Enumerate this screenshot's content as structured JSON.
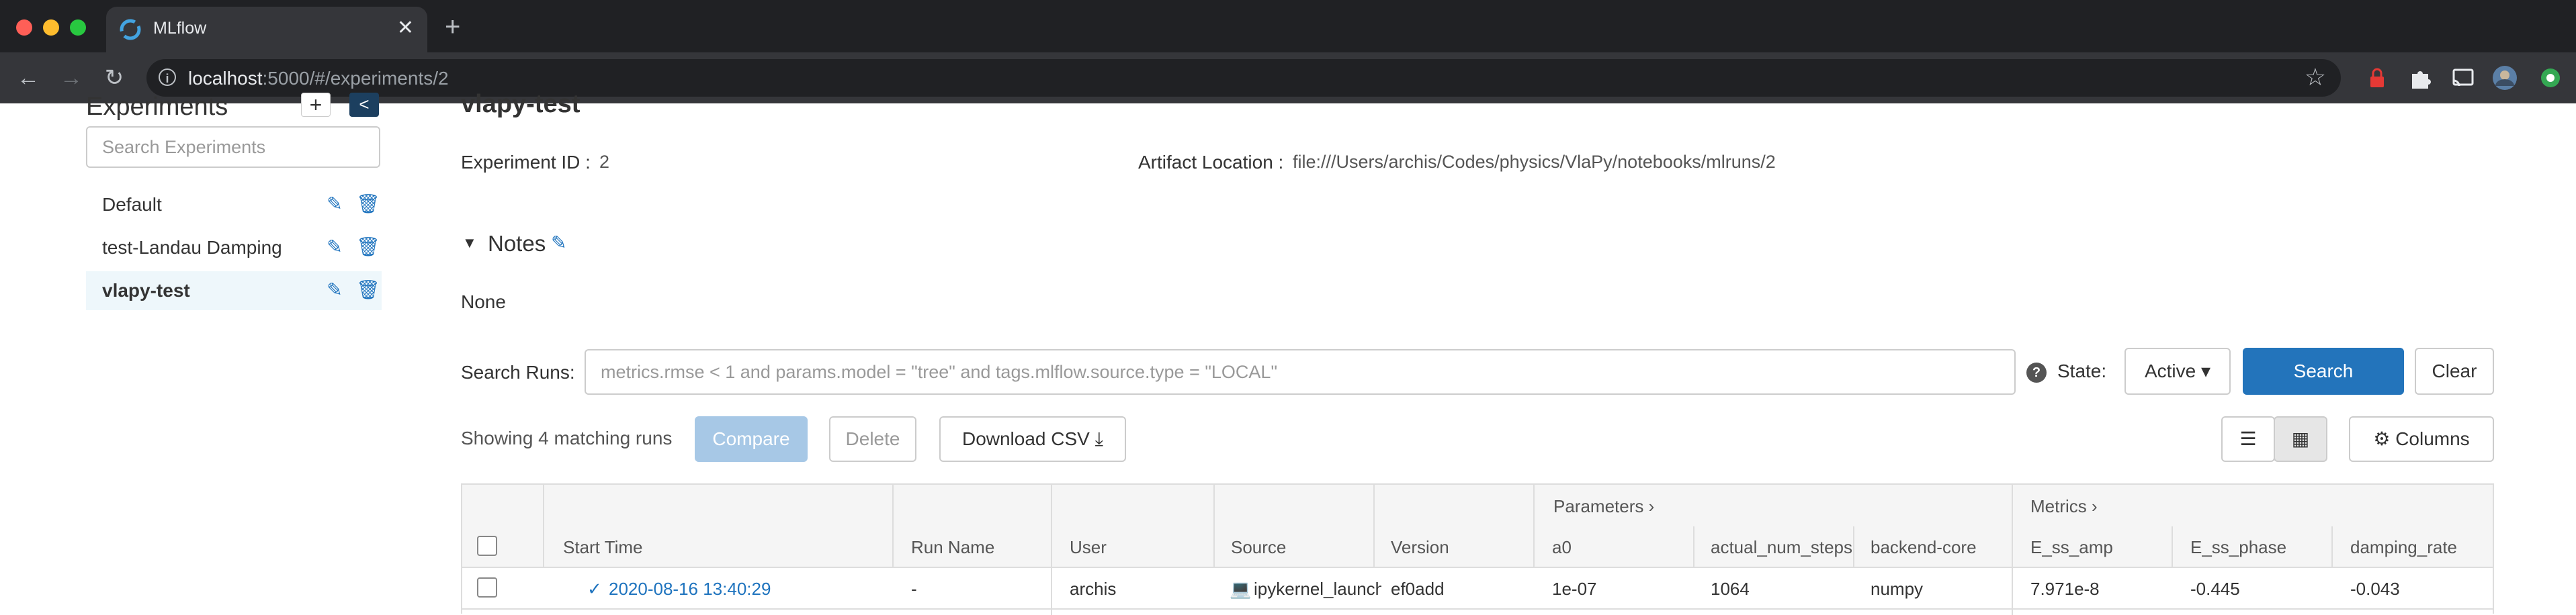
{
  "browser": {
    "tab_title": "MLflow",
    "close_glyph": "✕",
    "new_tab_glyph": "+",
    "url_host": "localhost",
    "url_rest": ":5000/#/experiments/2",
    "back_glyph": "←",
    "forward_glyph": "→",
    "reload_glyph": "↻",
    "info_glyph": "i",
    "star_glyph": "☆"
  },
  "sidebar": {
    "title": "Experiments",
    "add_glyph": "+",
    "collapse_glyph": "<",
    "search_placeholder": "Search Experiments",
    "edit_glyph": "✎",
    "delete_glyph": "🗑",
    "items": [
      {
        "label": "Default",
        "active": false
      },
      {
        "label": "test-Landau Damping",
        "active": false
      },
      {
        "label": "vlapy-test",
        "active": true
      }
    ]
  },
  "experiment": {
    "title": "vlapy-test",
    "id_label": "Experiment ID :",
    "id_value": "2",
    "artifact_label": "Artifact Location :",
    "artifact_value": "file:///Users/archis/Codes/physics/VlaPy/notebooks/mlruns/2"
  },
  "notes": {
    "toggle_glyph": "▼",
    "title": "Notes",
    "edit_glyph": "✎",
    "body": "None"
  },
  "search": {
    "label": "Search Runs:",
    "placeholder": "metrics.rmse < 1 and params.model = \"tree\" and tags.mlflow.source.type = \"LOCAL\"",
    "help_glyph": "?",
    "state_label": "State:",
    "state_value": "Active",
    "state_caret": "▾",
    "search_button": "Search",
    "clear_button": "Clear"
  },
  "runs_toolbar": {
    "showing_text": "Showing 4 matching runs",
    "compare": "Compare",
    "delete": "Delete",
    "download_csv": "Download CSV",
    "download_glyph": "⤓",
    "list_view_glyph": "☰",
    "grid_view_glyph": "▦",
    "columns_glyph": "⚙",
    "columns": "Columns"
  },
  "table": {
    "groups": {
      "parameters": "Parameters",
      "metrics": "Metrics",
      "chevron": "›"
    },
    "headers": {
      "start_time": "Start Time",
      "run_name": "Run Name",
      "user": "User",
      "source": "Source",
      "version": "Version",
      "a0": "a0",
      "actual_num_steps": "actual_num_steps",
      "backend_core": "backend-core",
      "e_ss_amp": "E_ss_amp",
      "e_ss_phase": "E_ss_phase",
      "damping_rate": "damping_rate"
    },
    "rows": [
      {
        "status_glyph": "✓",
        "start_time": "2020-08-16 13:40:29",
        "run_name": "-",
        "user": "archis",
        "source_glyph": "💻",
        "source": "ipykernel_launcher.py",
        "version": "ef0add",
        "a0": "1e-07",
        "actual_num_steps": "1064",
        "backend_core": "numpy",
        "e_ss_amp": "7.971e-8",
        "e_ss_phase": "-0.445",
        "damping_rate": "-0.043"
      }
    ]
  },
  "colors": {
    "accent": "#2374bb",
    "link": "#1e73be",
    "active_bg": "#eef7fb",
    "chrome_dark": "#202124",
    "chrome_toolbar": "#35363a"
  }
}
